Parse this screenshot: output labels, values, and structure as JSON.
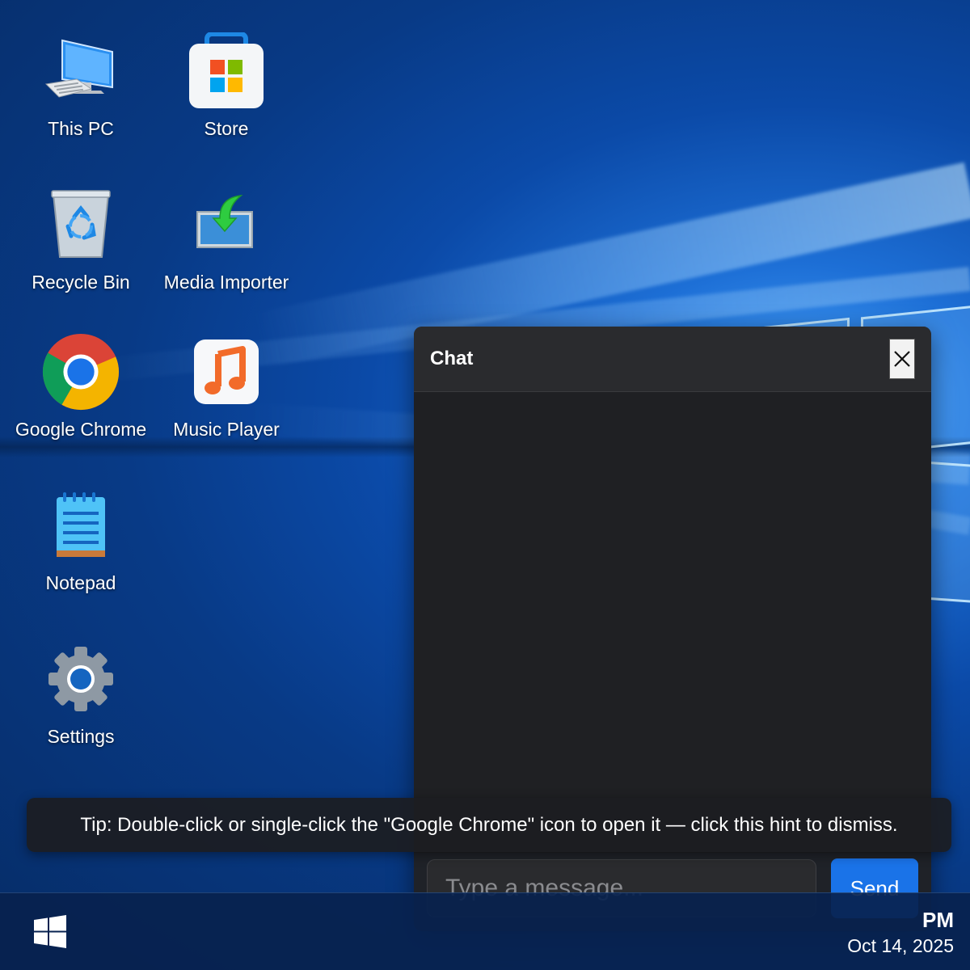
{
  "desktop": {
    "icons": [
      {
        "label": "This PC",
        "icon": "computer-icon"
      },
      {
        "label": "Store",
        "icon": "store-icon"
      },
      {
        "label": "Recycle Bin",
        "icon": "recycle-bin-icon"
      },
      {
        "label": "Media Importer",
        "icon": "media-importer-icon"
      },
      {
        "label": "Google Chrome",
        "icon": "chrome-icon"
      },
      {
        "label": "Music Player",
        "icon": "music-note-icon"
      },
      {
        "label": "Notepad",
        "icon": "notepad-icon"
      },
      {
        "label": "Settings",
        "icon": "gear-icon"
      }
    ]
  },
  "chat": {
    "title": "Chat",
    "input_placeholder": "Type a message...",
    "send_label": "Send"
  },
  "tip": {
    "text": "Tip: Double-click or single-click the \"Google Chrome\" icon to open it — click this hint to dismiss."
  },
  "taskbar": {
    "time": "PM",
    "date": "Oct 14, 2025"
  },
  "colors": {
    "accent": "#1a73e8",
    "chat_bg": "#202124",
    "wallpaper": "#0b4aa8"
  }
}
